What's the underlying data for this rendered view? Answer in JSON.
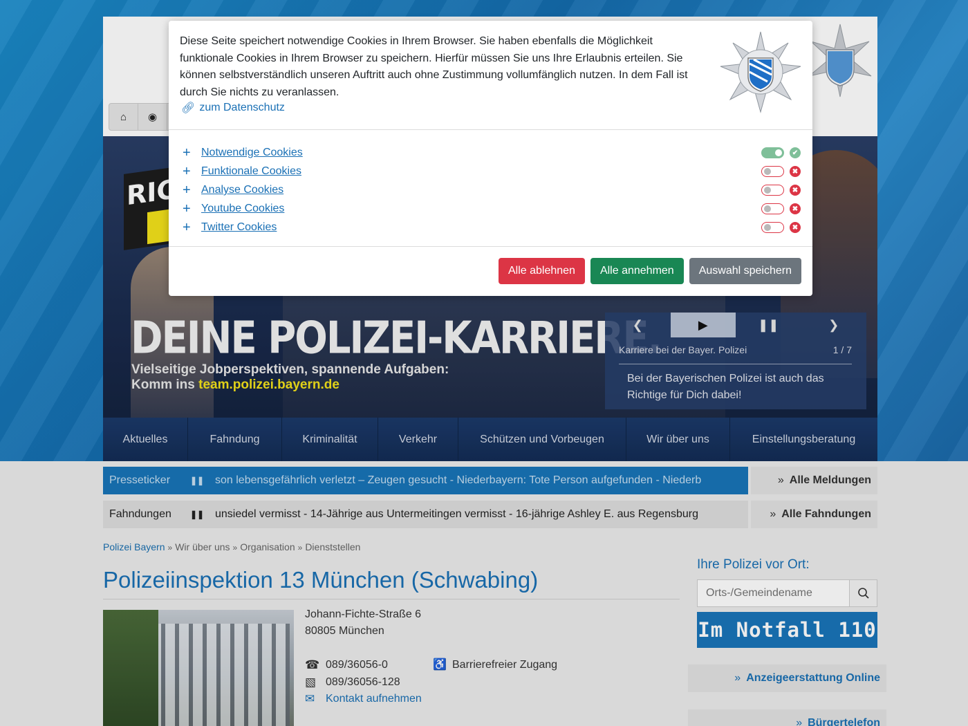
{
  "hero": {
    "badge_text": "RIC",
    "headline": "DEINE POLIZEI-KARRIERE.",
    "sub_line1": "Vielseitige Jobperspektiven, spannende Aufgaben:",
    "sub_line2_prefix": "Komm ins ",
    "sub_line2_link": "team.polizei.bayern.de"
  },
  "slider": {
    "caption": "Karriere bei der Bayer. Polizei",
    "counter": "1 / 7",
    "text": "Bei der Bayerischen Polizei ist auch das Richtige für Dich dabei!"
  },
  "nav": [
    {
      "label": "Aktuelles",
      "w": 123
    },
    {
      "label": "Fahndung",
      "w": 136
    },
    {
      "label": "Kriminalität",
      "w": 139
    },
    {
      "label": "Verkehr",
      "w": 116
    },
    {
      "label": "Schützen und Vorbeugen",
      "w": 243
    },
    {
      "label": "Wir über uns",
      "w": 150
    },
    {
      "label": "Einstellungsberatung",
      "w": 213
    }
  ],
  "tickers": {
    "presse_label": "Presseticker",
    "presse_text": "son lebensgefährlich verletzt – Zeugen gesucht   -   Niederbayern: Tote Person aufgefunden   -   Niederb",
    "presse_button": "Alle Meldungen",
    "fahndung_label": "Fahndungen",
    "fahndung_text": "unsiedel vermisst   -   14-Jährige aus Untermeitingen vermisst   -   16-jährige Ashley E. aus Regensburg",
    "fahndung_button": "Alle Fahndungen"
  },
  "breadcrumb": [
    "Polizei Bayern",
    "Wir über uns",
    "Organisation",
    "Dienststellen"
  ],
  "page_title": "Polizeiinspektion 13 München (Schwabing)",
  "address": {
    "street": "Johann-Fichte-Straße 6",
    "city": "80805 München"
  },
  "contact": {
    "phone": "089/36056-0",
    "fax": "089/36056-128",
    "mail_link": "Kontakt aufnehmen",
    "accessibility": "Barrierefreier Zugang"
  },
  "sidebar": {
    "heading": "Ihre Polizei vor Ort:",
    "search_placeholder": "Orts-/Gemeindename",
    "emergency": "Im Notfall 110",
    "link1": "Anzeigeerstattung Online",
    "link2": "Bürgertelefon"
  },
  "cookie_modal": {
    "text": "Diese Seite speichert notwendige Cookies in Ihrem Browser. Sie haben ebenfalls die Möglichkeit funktionale Cookies in Ihrem Browser zu speichern. Hierfür müssen Sie uns Ihre Erlaubnis erteilen. Sie können selbstverständlich unseren Auftritt auch ohne Zustimmung vollumfänglich nutzen. In dem Fall ist durch Sie nichts zu veranlassen.",
    "privacy_link": "zum Datenschutz",
    "categories": [
      {
        "name": "Notwendige Cookies",
        "enabled": true
      },
      {
        "name": "Funktionale Cookies",
        "enabled": false
      },
      {
        "name": "Analyse Cookies",
        "enabled": false
      },
      {
        "name": "Youtube Cookies",
        "enabled": false
      },
      {
        "name": "Twitter Cookies",
        "enabled": false
      }
    ],
    "btn_reject": "Alle ablehnen",
    "btn_accept": "Alle annehmen",
    "btn_save": "Auswahl speichern"
  },
  "colors": {
    "brand_blue": "#1a70b5",
    "reject_red": "#dc3545",
    "accept_green": "#198754",
    "save_gray": "#6c757d",
    "toggle_on": "#7fbf99"
  }
}
